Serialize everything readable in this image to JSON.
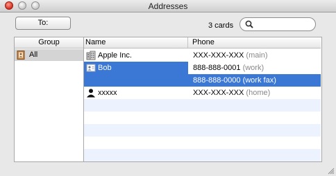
{
  "window": {
    "title": "Addresses"
  },
  "toolbar": {
    "to_label": "To:",
    "count": "3 cards",
    "search": {
      "value": "",
      "placeholder": ""
    }
  },
  "columns": {
    "group": "Group",
    "name": "Name",
    "phone": "Phone"
  },
  "groups": [
    {
      "label": "All"
    }
  ],
  "contacts": [
    {
      "name": "Apple Inc.",
      "phones": [
        {
          "number": "XXX-XXX-XXX",
          "label": "(main)"
        }
      ]
    },
    {
      "name": "Bob",
      "phones": [
        {
          "number": "888-888-0001",
          "label": "(work)"
        },
        {
          "number": "888-888-0000",
          "label": "(work fax)"
        }
      ]
    },
    {
      "name": "xxxxx",
      "phones": [
        {
          "number": "XXX-XXX-XXX",
          "label": "(home)"
        }
      ]
    }
  ],
  "colors": {
    "selection": "#3b78d6",
    "stripe": "#edf3fe"
  },
  "icons": {
    "group": "address-book-icon",
    "company": "building-icon",
    "person_card": "vcard-icon",
    "person": "person-silhouette-icon"
  }
}
